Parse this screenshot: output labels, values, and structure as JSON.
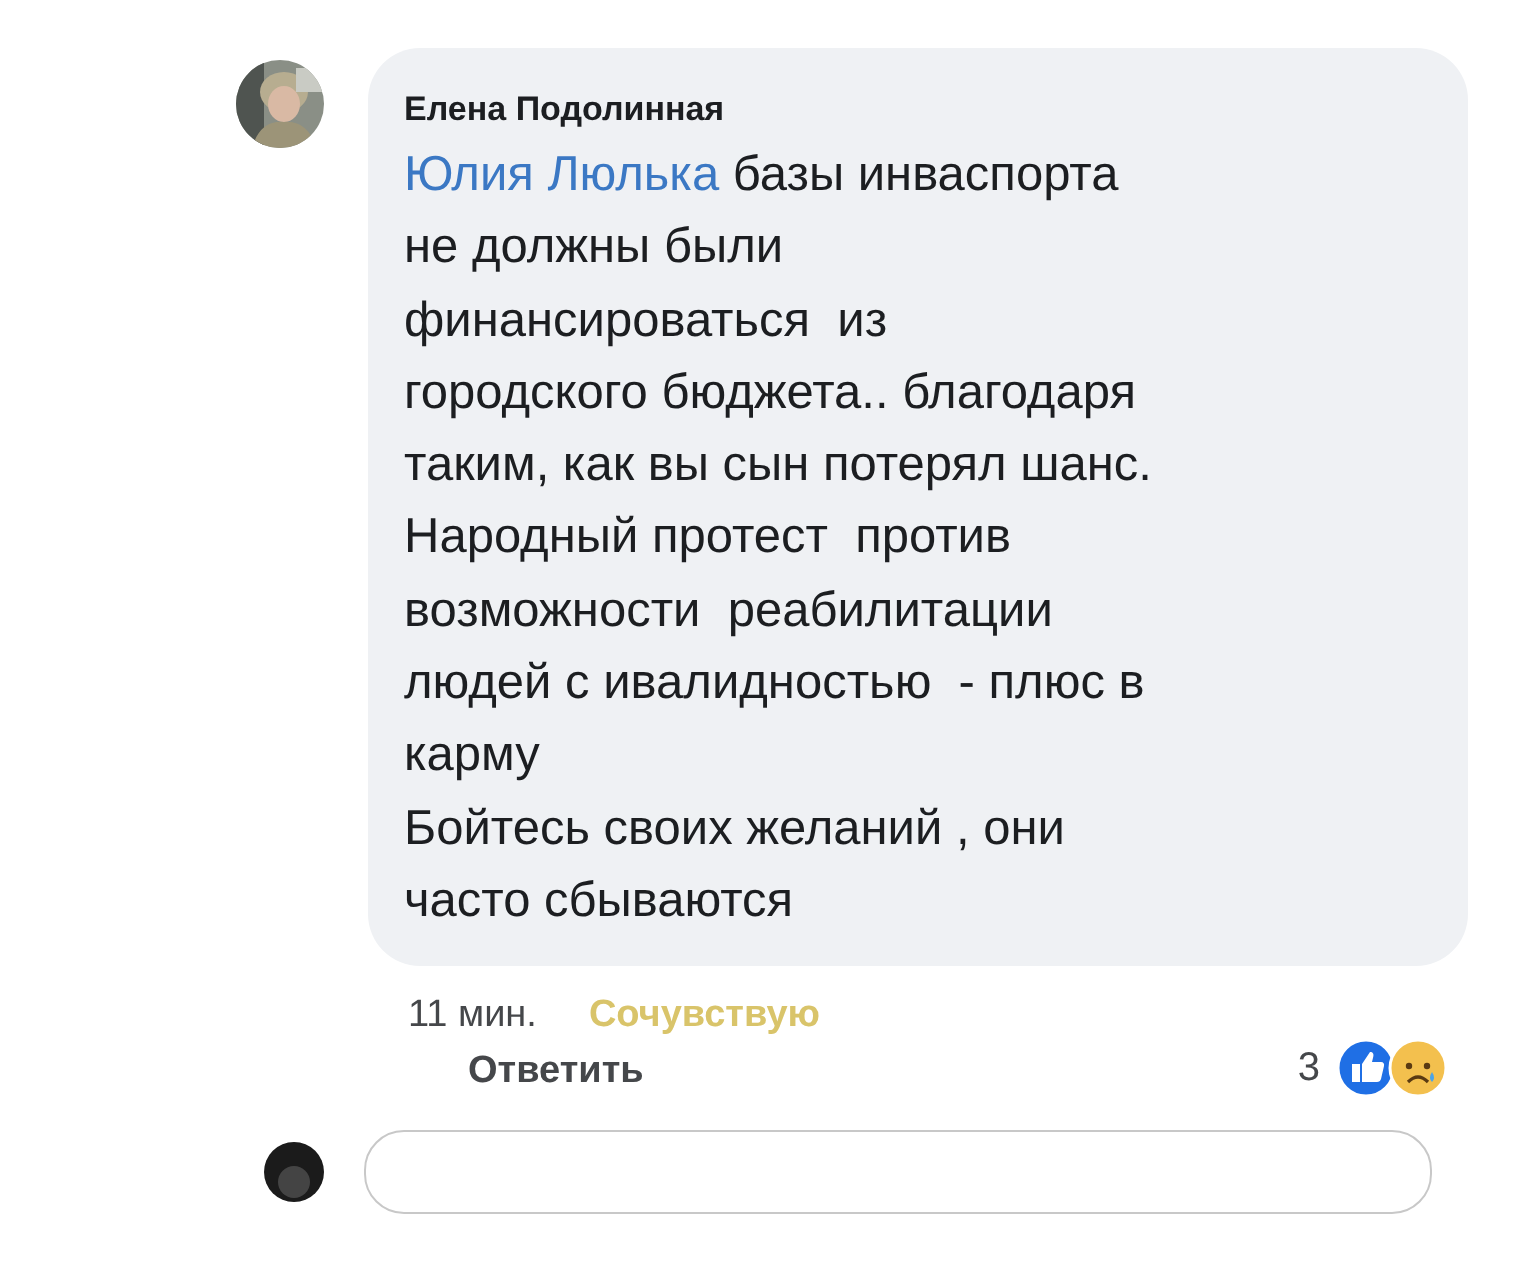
{
  "comment": {
    "author": "Елена Подолинная",
    "mention": "Юлия Люлька",
    "text": " базы инваспорта\nне должны были\nфинансироваться  из\nгородского бюджета.. благодаря\nтаким, как вы сын потерял шанс.\nНародный протест  против\nвозможности  реабилитации\nлюдей с ивалидностью  - плюс в\nкарму\nБойтесь своих желаний , они\nчасто сбываются",
    "time": "11 мин.",
    "reaction_label": "Сочувствую",
    "reply": "Ответить",
    "reaction_count": "3"
  }
}
